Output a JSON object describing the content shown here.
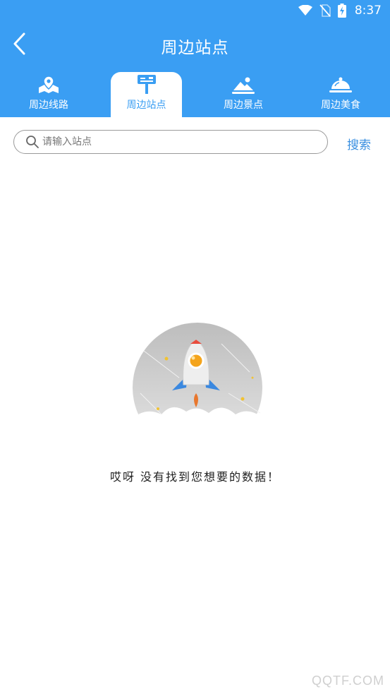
{
  "status_bar": {
    "time": "8:37"
  },
  "nav": {
    "title": "周边站点"
  },
  "tabs": [
    {
      "label": "周边线路",
      "icon": "map-pin-icon",
      "active": false
    },
    {
      "label": "周边站点",
      "icon": "bus-stop-sign-icon",
      "active": true
    },
    {
      "label": "周边景点",
      "icon": "scenery-mountain-icon",
      "active": false
    },
    {
      "label": "周边美食",
      "icon": "food-dome-icon",
      "active": false
    }
  ],
  "search": {
    "placeholder": "请输入站点",
    "value": "",
    "button_label": "搜索"
  },
  "empty_state": {
    "message": "哎呀 没有找到您想要的数据！",
    "illustration": "rocket-illustration"
  },
  "watermark": "QQTF.COM",
  "colors": {
    "primary": "#3a9ef3",
    "link": "#3a8fe0",
    "background": "#ffffff"
  }
}
